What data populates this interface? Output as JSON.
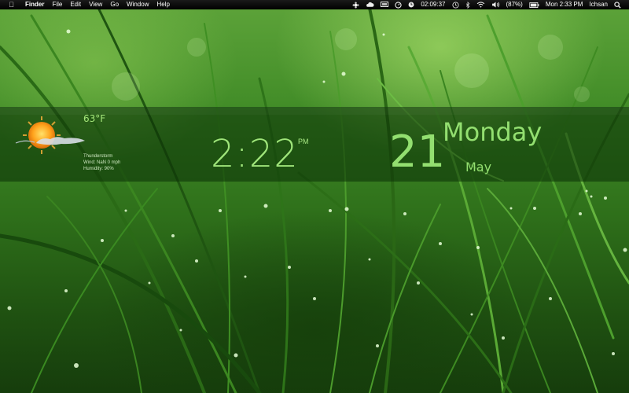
{
  "menubar": {
    "apple_icon": "apple-icon",
    "items": [
      {
        "label": "Finder",
        "bold": true
      },
      {
        "label": "File"
      },
      {
        "label": "Edit"
      },
      {
        "label": "View"
      },
      {
        "label": "Go"
      },
      {
        "label": "Window"
      },
      {
        "label": "Help"
      }
    ],
    "status": {
      "timer": "02:09:37",
      "battery_percent": "(87%)",
      "clock": "Mon 2:33 PM",
      "user": "Ichsan"
    }
  },
  "weather": {
    "temperature": "63°F",
    "condition": "Thunderstorm",
    "wind": "Wind: NaN 0 mph",
    "humidity": "Humidity: 90%"
  },
  "clock": {
    "time": "2:22",
    "ampm": "PM"
  },
  "date": {
    "day": "21",
    "weekday": "Monday",
    "month": "May"
  },
  "colors": {
    "widget_text": "#93df70",
    "menubar_bg": "#000000"
  }
}
